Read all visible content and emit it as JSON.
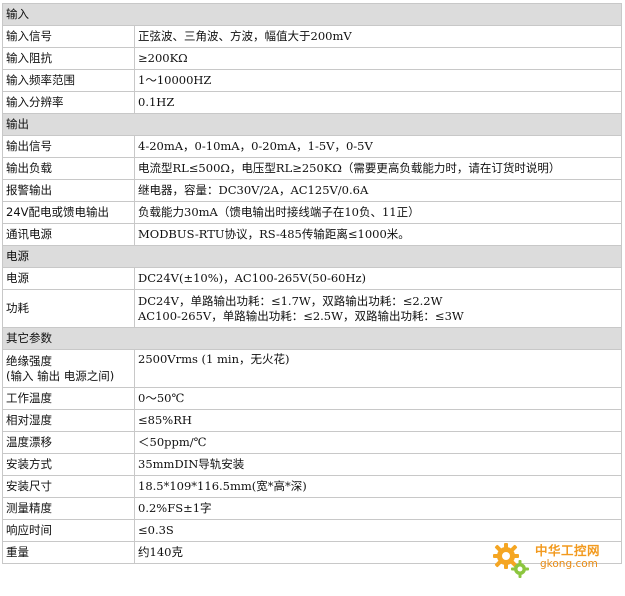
{
  "sections": [
    {
      "title": "输入",
      "rows": [
        {
          "label": "输入信号",
          "lines": [
            "正弦波、三角波、方波，幅值大于200mV"
          ]
        },
        {
          "label": "输入阻抗",
          "lines": [
            "≥200KΩ"
          ]
        },
        {
          "label": "输入频率范围",
          "lines": [
            "1～10000HZ"
          ]
        },
        {
          "label": "输入分辨率",
          "lines": [
            "0.1HZ"
          ]
        }
      ]
    },
    {
      "title": "输出",
      "rows": [
        {
          "label": "输出信号",
          "lines": [
            "4-20mA，0-10mA，0-20mA，1-5V，0-5V"
          ]
        },
        {
          "label": "输出负载",
          "lines": [
            "电流型RL≤500Ω，电压型RL≥250KΩ（需要更高负载能力时，请在订货时说明）"
          ]
        },
        {
          "label": "报警输出",
          "lines": [
            "继电器，容量：DC30V/2A，AC125V/0.6A"
          ]
        },
        {
          "label": "24V配电或馈电输出",
          "lines": [
            "负载能力30mA（馈电输出时接线端子在10负、11正）"
          ]
        },
        {
          "label": "通讯电源",
          "lines": [
            "MODBUS-RTU协议，RS-485传输距离≤1000米。"
          ]
        }
      ]
    },
    {
      "title": "电源",
      "rows": [
        {
          "label": "电源",
          "lines": [
            "DC24V(±10%)，AC100-265V(50-60Hz)"
          ]
        },
        {
          "label": "功耗",
          "lines": [
            "DC24V，单路输出功耗：≤1.7W，双路输出功耗：≤2.2W",
            "AC100-265V，单路输出功耗：≤2.5W，双路输出功耗：≤3W"
          ]
        }
      ]
    },
    {
      "title": "其它参数",
      "rows": [
        {
          "label": "绝缘强度",
          "label2": "(输入 输出 电源之间)",
          "lines": [
            "2500Vrms (1 min，无火花)"
          ]
        },
        {
          "label": "工作温度",
          "lines": [
            "0～50℃"
          ]
        },
        {
          "label": "相对湿度",
          "lines": [
            "≤85%RH"
          ]
        },
        {
          "label": "温度漂移",
          "lines": [
            "＜50ppm/℃"
          ]
        },
        {
          "label": "安装方式",
          "lines": [
            "35mmDIN导轨安装"
          ]
        },
        {
          "label": "安装尺寸",
          "lines": [
            "18.5*109*116.5mm(宽*高*深)"
          ]
        },
        {
          "label": "测量精度",
          "lines": [
            "0.2%FS±1字"
          ]
        },
        {
          "label": "响应时间",
          "lines": [
            "≤0.3S"
          ]
        },
        {
          "label": "重量",
          "lines": [
            "约140克"
          ]
        }
      ]
    }
  ],
  "watermark": {
    "text_cn": "中华工控网",
    "text_en": "gkong.com",
    "icon": "gear-icon",
    "color": "#f29a1f"
  }
}
